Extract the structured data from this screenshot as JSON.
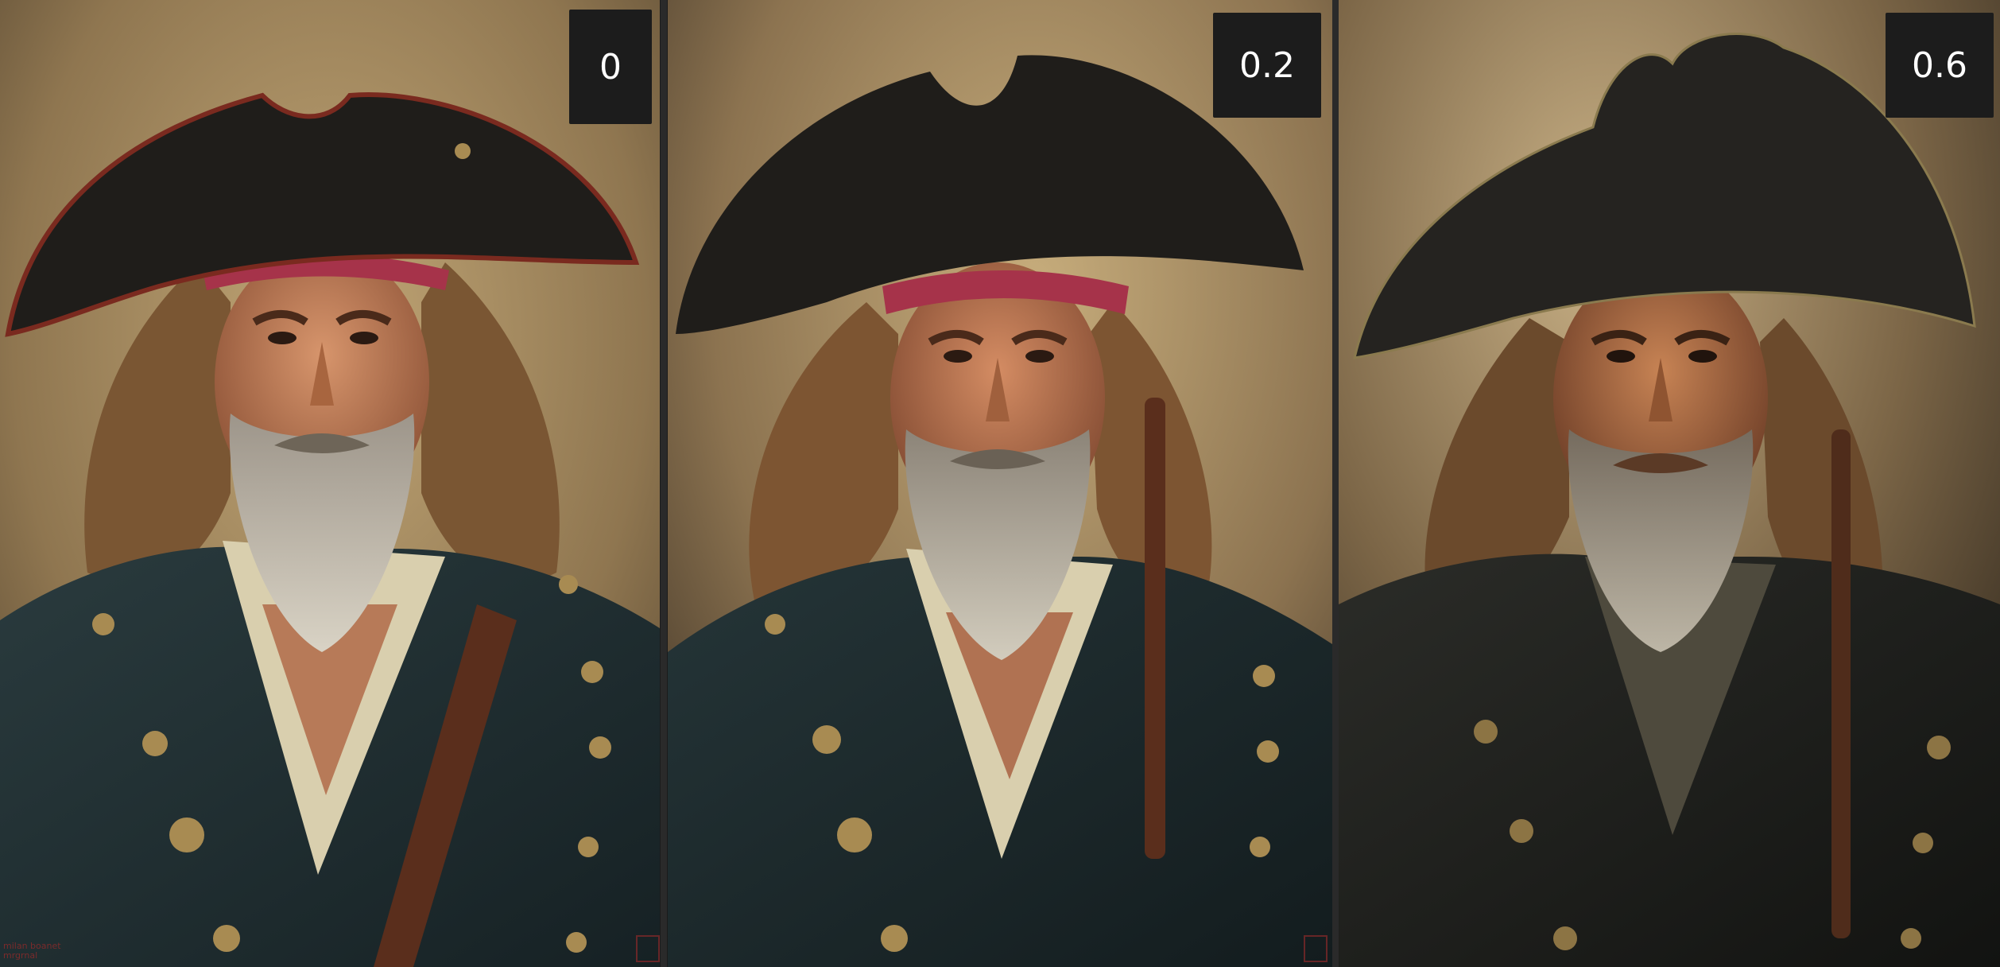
{
  "panels": [
    {
      "id": "panel-0",
      "strength_label": "0",
      "signature_line1": "milan boanet",
      "signature_line2": "mrgrnal"
    },
    {
      "id": "panel-1",
      "strength_label": "0.2",
      "signature_line1": ""
    },
    {
      "id": "panel-2",
      "strength_label": "0.6"
    }
  ],
  "colors": {
    "background_warm": "#b79a6a",
    "background_dark": "#3b3125",
    "hat": "#1f1d1a",
    "hat_trim_red": "#7a2a1f",
    "bandana": "#a6334a",
    "coat": "#1e2a2c",
    "skin": "#c07a55",
    "beard": "#bdb7a6",
    "hair": "#7a5633",
    "shirt": "#d9cfae",
    "button_gold": "#a88b52",
    "badge_bg": "#1c1c1c",
    "badge_text": "#ffffff"
  }
}
